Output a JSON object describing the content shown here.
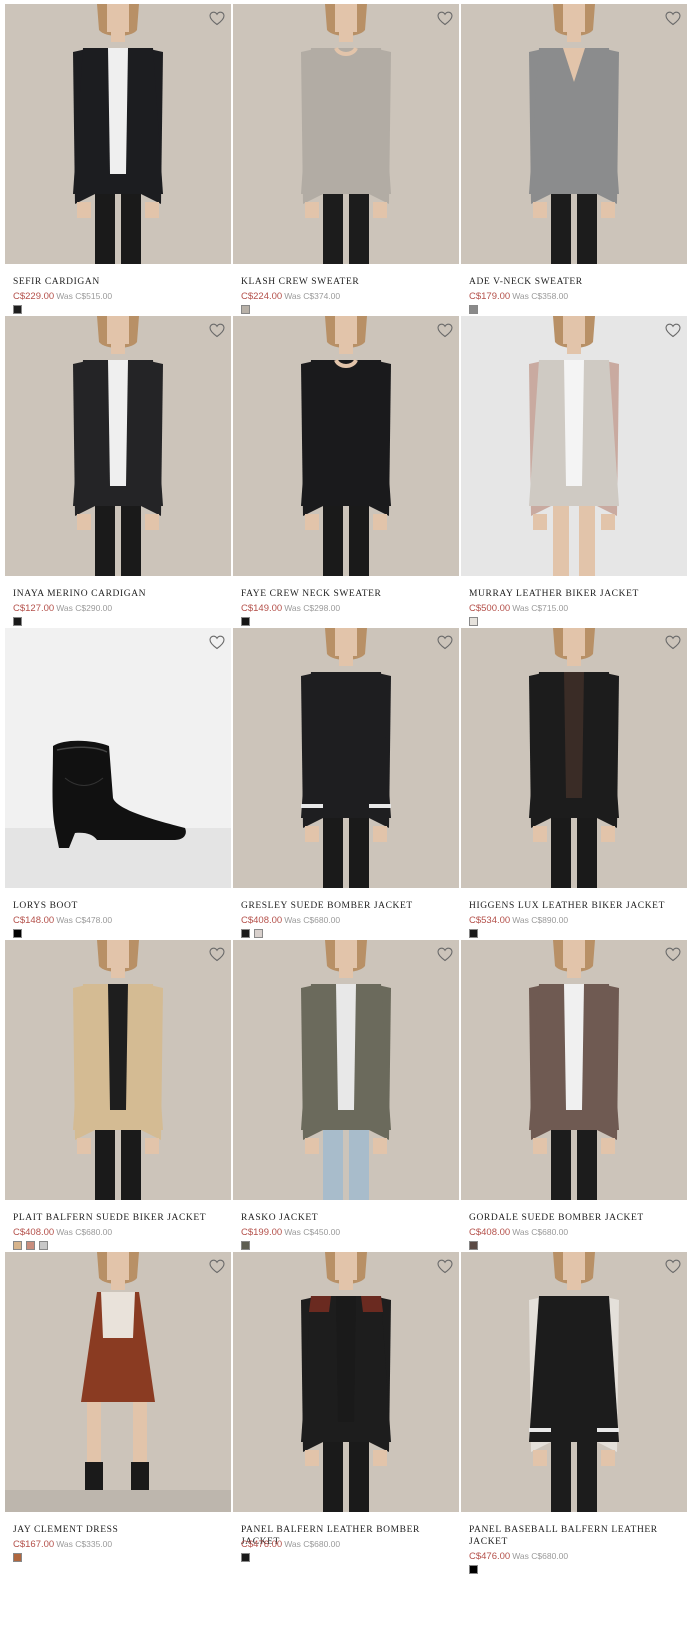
{
  "colors": {
    "price": "#b4504a",
    "was": "#9a9a9a",
    "name": "#222222"
  },
  "products": [
    {
      "name": "SEFIR CARDIGAN",
      "price": "C$229.00",
      "was": "Was C$515.00",
      "swatches": [
        "#1e1e1e"
      ],
      "image": {
        "kind": "model",
        "bg": "#ccc4ba",
        "top": "#1c1d20",
        "inner": "#efefef",
        "pants": "#1a1a1a",
        "style": "open"
      },
      "wishlist_icon": "heart-outline-icon"
    },
    {
      "name": "KLASH CREW SWEATER",
      "price": "C$224.00",
      "was": "Was C$374.00",
      "swatches": [
        "#b8b1a8"
      ],
      "image": {
        "kind": "model",
        "bg": "#ccc4ba",
        "top": "#b2aca4",
        "inner": "#b2aca4",
        "pants": "#1c1c1c",
        "style": "crew"
      },
      "wishlist_icon": "heart-outline-icon"
    },
    {
      "name": "ADE V-NECK SWEATER",
      "price": "C$179.00",
      "was": "Was C$358.00",
      "swatches": [
        "#8a8a8a"
      ],
      "image": {
        "kind": "model",
        "bg": "#ccc4ba",
        "top": "#8b8c8d",
        "inner": "#8b8c8d",
        "pants": "#1c1c1c",
        "style": "vneck"
      },
      "wishlist_icon": "heart-outline-icon"
    },
    {
      "name": "INAYA MERINO CARDIGAN",
      "price": "C$127.00",
      "was": "Was C$290.00",
      "swatches": [
        "#1a1a1a"
      ],
      "image": {
        "kind": "model",
        "bg": "#ccc4ba",
        "top": "#242426",
        "inner": "#efefef",
        "pants": "#1a1a1a",
        "style": "open"
      },
      "wishlist_icon": "heart-outline-icon"
    },
    {
      "name": "FAYE CREW NECK SWEATER",
      "price": "C$149.00",
      "was": "Was C$298.00",
      "swatches": [
        "#151515"
      ],
      "image": {
        "kind": "model",
        "bg": "#ccc4ba",
        "top": "#1a1a1c",
        "inner": "#1a1a1c",
        "pants": "#1a1a1a",
        "style": "crew"
      },
      "wishlist_icon": "heart-outline-icon"
    },
    {
      "name": "MURRAY LEATHER BIKER JACKET",
      "price": "C$500.00",
      "was": "Was C$715.00",
      "swatches": [
        "#e6e2dc"
      ],
      "image": {
        "kind": "model",
        "bg": "#e6e6e6",
        "top": "#cfcac3",
        "inner": "#f4f4f4",
        "pants": "#2a2a2a",
        "style": "shorts",
        "sleeve": "#c9aaa0"
      },
      "wishlist_icon": "heart-outline-icon"
    },
    {
      "name": "LORYS BOOT",
      "price": "C$148.00",
      "was": "Was C$478.00",
      "swatches": [
        "#000000"
      ],
      "image": {
        "kind": "boot",
        "bg": "#f1f1f1"
      },
      "wishlist_icon": "heart-outline-icon"
    },
    {
      "name": "GRESLEY SUEDE BOMBER JACKET",
      "price": "C$408.00",
      "was": "Was C$680.00",
      "swatches": [
        "#1a1a1a",
        "#d8d0cc"
      ],
      "image": {
        "kind": "model",
        "bg": "#ccc4ba",
        "top": "#1e1e20",
        "inner": "#2c2c30",
        "pants": "#1a1a1a",
        "style": "bomber"
      },
      "wishlist_icon": "heart-outline-icon"
    },
    {
      "name": "HIGGENS LUX LEATHER BIKER JACKET",
      "price": "C$534.00",
      "was": "Was C$890.00",
      "swatches": [
        "#1a1a1a"
      ],
      "image": {
        "kind": "model",
        "bg": "#ccc4ba",
        "top": "#1c1c1c",
        "inner": "#3a2c26",
        "pants": "#1a1a1a",
        "style": "open"
      },
      "wishlist_icon": "heart-outline-icon"
    },
    {
      "name": "PLAIT BALFERN SUEDE BIKER JACKET",
      "price": "C$408.00",
      "was": "Was C$680.00",
      "swatches": [
        "#d7b48c",
        "#c98e7e",
        "#c8c8c8"
      ],
      "image": {
        "kind": "model",
        "bg": "#ccc4ba",
        "top": "#d4bb93",
        "inner": "#1e1e1e",
        "pants": "#1a1a1a",
        "style": "open"
      },
      "wishlist_icon": "heart-outline-icon"
    },
    {
      "name": "RASKO JACKET",
      "price": "C$199.00",
      "was": "Was C$450.00",
      "swatches": [
        "#5e5e52"
      ],
      "image": {
        "kind": "model",
        "bg": "#ccc4ba",
        "top": "#6b6a5c",
        "inner": "#e8e8e8",
        "pants": "#a8bccb",
        "style": "camo"
      },
      "wishlist_icon": "heart-outline-icon"
    },
    {
      "name": "GORDALE SUEDE BOMBER JACKET",
      "price": "C$408.00",
      "was": "Was C$680.00",
      "swatches": [
        "#5a4a44"
      ],
      "image": {
        "kind": "model",
        "bg": "#ccc4ba",
        "top": "#6f5a52",
        "inner": "#f0f0f0",
        "pants": "#1c1c1c",
        "style": "open"
      },
      "wishlist_icon": "heart-outline-icon"
    },
    {
      "name": "JAY CLEMENT DRESS",
      "price": "C$167.00",
      "was": "Was C$335.00",
      "swatches": [
        "#b0673f"
      ],
      "image": {
        "kind": "model",
        "bg": "#ccc4ba",
        "top": "#8a3b22",
        "inner": "#e9e2da",
        "pants": "#8a3b22",
        "style": "dress"
      },
      "wishlist_icon": "heart-outline-icon"
    },
    {
      "name": "PANEL BALFERN LEATHER BOMBER JACKET",
      "price": "C$476.00",
      "was": "Was C$680.00",
      "swatches": [
        "#1a1a1a"
      ],
      "image": {
        "kind": "model",
        "bg": "#ccc4ba",
        "top": "#1d1d1d",
        "inner": "#1a1a1a",
        "pants": "#1a1a1a",
        "style": "open",
        "accent": "#6a2a20"
      },
      "wishlist_icon": "heart-outline-icon"
    },
    {
      "name": "PANEL BASEBALL BALFERN LEATHER JACKET",
      "price": "C$476.00",
      "was": "Was C$680.00",
      "swatches": [
        "#000000"
      ],
      "image": {
        "kind": "model",
        "bg": "#ccc4ba",
        "top": "#1c1c1c",
        "inner": "#1c1c1c",
        "pants": "#1c1c1c",
        "style": "bomber",
        "sleeve": "#e4e0da"
      },
      "wishlist_icon": "heart-outline-icon"
    }
  ]
}
